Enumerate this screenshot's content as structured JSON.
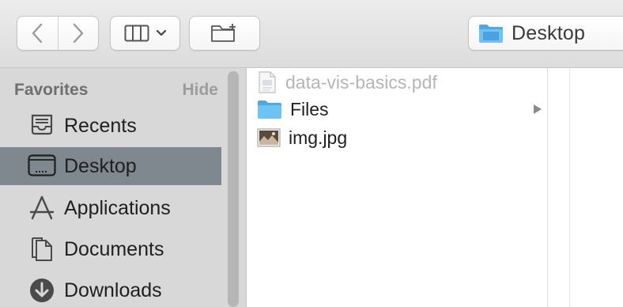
{
  "toolbar": {
    "back_icon": "chevron-left-icon",
    "forward_icon": "chevron-right-icon",
    "view_icon": "columns-view-icon",
    "new_folder_icon": "new-folder-icon",
    "path_label": "Desktop"
  },
  "sidebar": {
    "section_title": "Favorites",
    "hide_label": "Hide",
    "items": [
      {
        "label": "Recents",
        "icon": "recents-icon"
      },
      {
        "label": "Desktop",
        "icon": "desktop-icon",
        "selected": true
      },
      {
        "label": "Applications",
        "icon": "applications-icon"
      },
      {
        "label": "Documents",
        "icon": "documents-icon"
      },
      {
        "label": "Downloads",
        "icon": "downloads-icon"
      }
    ]
  },
  "files": [
    {
      "name": "data-vis-basics.pdf",
      "icon": "pdf-file-icon",
      "dimmed": true
    },
    {
      "name": "Files",
      "icon": "folder-icon",
      "has_children": true
    },
    {
      "name": "img.jpg",
      "icon": "image-file-icon"
    }
  ],
  "colors": {
    "selected_row": "#7f878f",
    "sidebar_bg": "#d8d8d8",
    "folder_blue": "#6ec3f5"
  }
}
